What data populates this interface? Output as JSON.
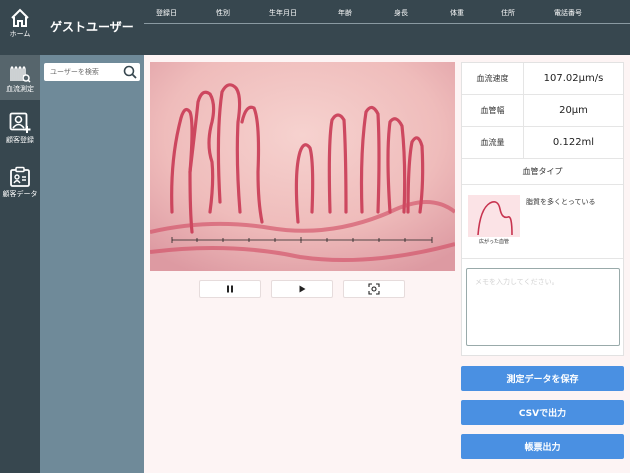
{
  "nav": {
    "home_label": "ホーム",
    "measure_label": "血流測定",
    "register_label": "顧客登録",
    "data_label": "顧客データ"
  },
  "user_panel": {
    "title": "ゲストユーザー",
    "search_placeholder": "ユーザーを検索"
  },
  "header": {
    "columns": [
      "登録日",
      "性別",
      "生年月日",
      "年齢",
      "身長",
      "体重",
      "住所",
      "電話番号"
    ]
  },
  "metrics": {
    "speed_label": "血流速度",
    "speed_value": "107.02μm/s",
    "width_label": "血管幅",
    "width_value": "20μm",
    "volume_label": "血流量",
    "volume_value": "0.122ml"
  },
  "vessel_type": {
    "title": "血管タイプ",
    "caption": "広がった血管",
    "description": "脂質を多くとっている"
  },
  "memo": {
    "placeholder": "メモを入力してください。"
  },
  "actions": {
    "save_label": "測定データを保存",
    "csv_label": "CSVで出力",
    "report_label": "帳票出力"
  },
  "colors": {
    "sidebar": "#37474f",
    "panel": "#6f8a99",
    "accent": "#4a90e2",
    "background": "#fdf4f4"
  }
}
